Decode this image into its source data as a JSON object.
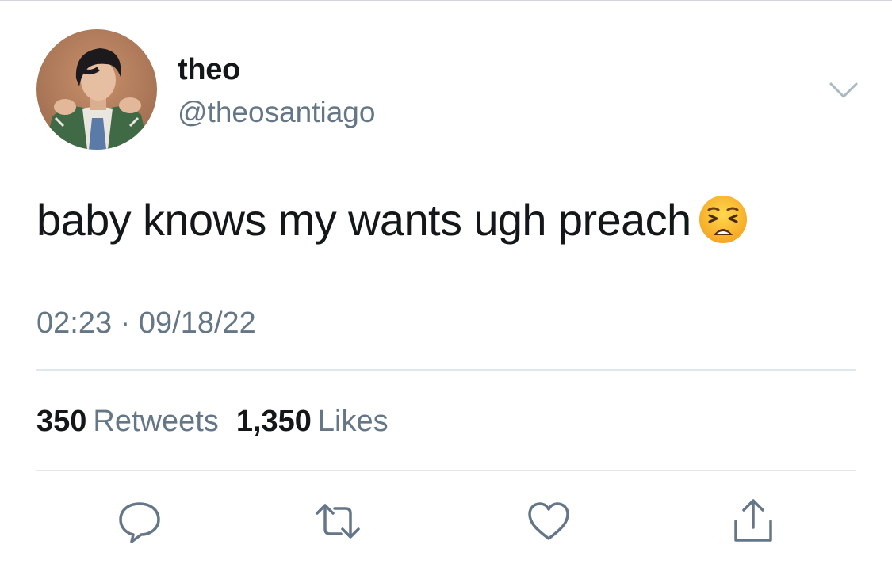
{
  "tweet": {
    "author": {
      "display_name": "theo",
      "handle": "@theosantiago"
    },
    "text": "baby knows my wants ugh preach",
    "emoji": "weary-face",
    "time": "02:23",
    "separator": "·",
    "date": "09/18/22"
  },
  "stats": {
    "retweets_count": "350",
    "retweets_label": "Retweets",
    "likes_count": "1,350",
    "likes_label": "Likes"
  },
  "icons": {
    "caret": "chevron-down-icon",
    "reply": "reply-icon",
    "retweet": "retweet-icon",
    "like": "heart-icon",
    "share": "share-icon"
  },
  "colors": {
    "text": "#14171a",
    "secondary": "#657786",
    "divider": "#e1e8ed",
    "icon": "#657786"
  }
}
